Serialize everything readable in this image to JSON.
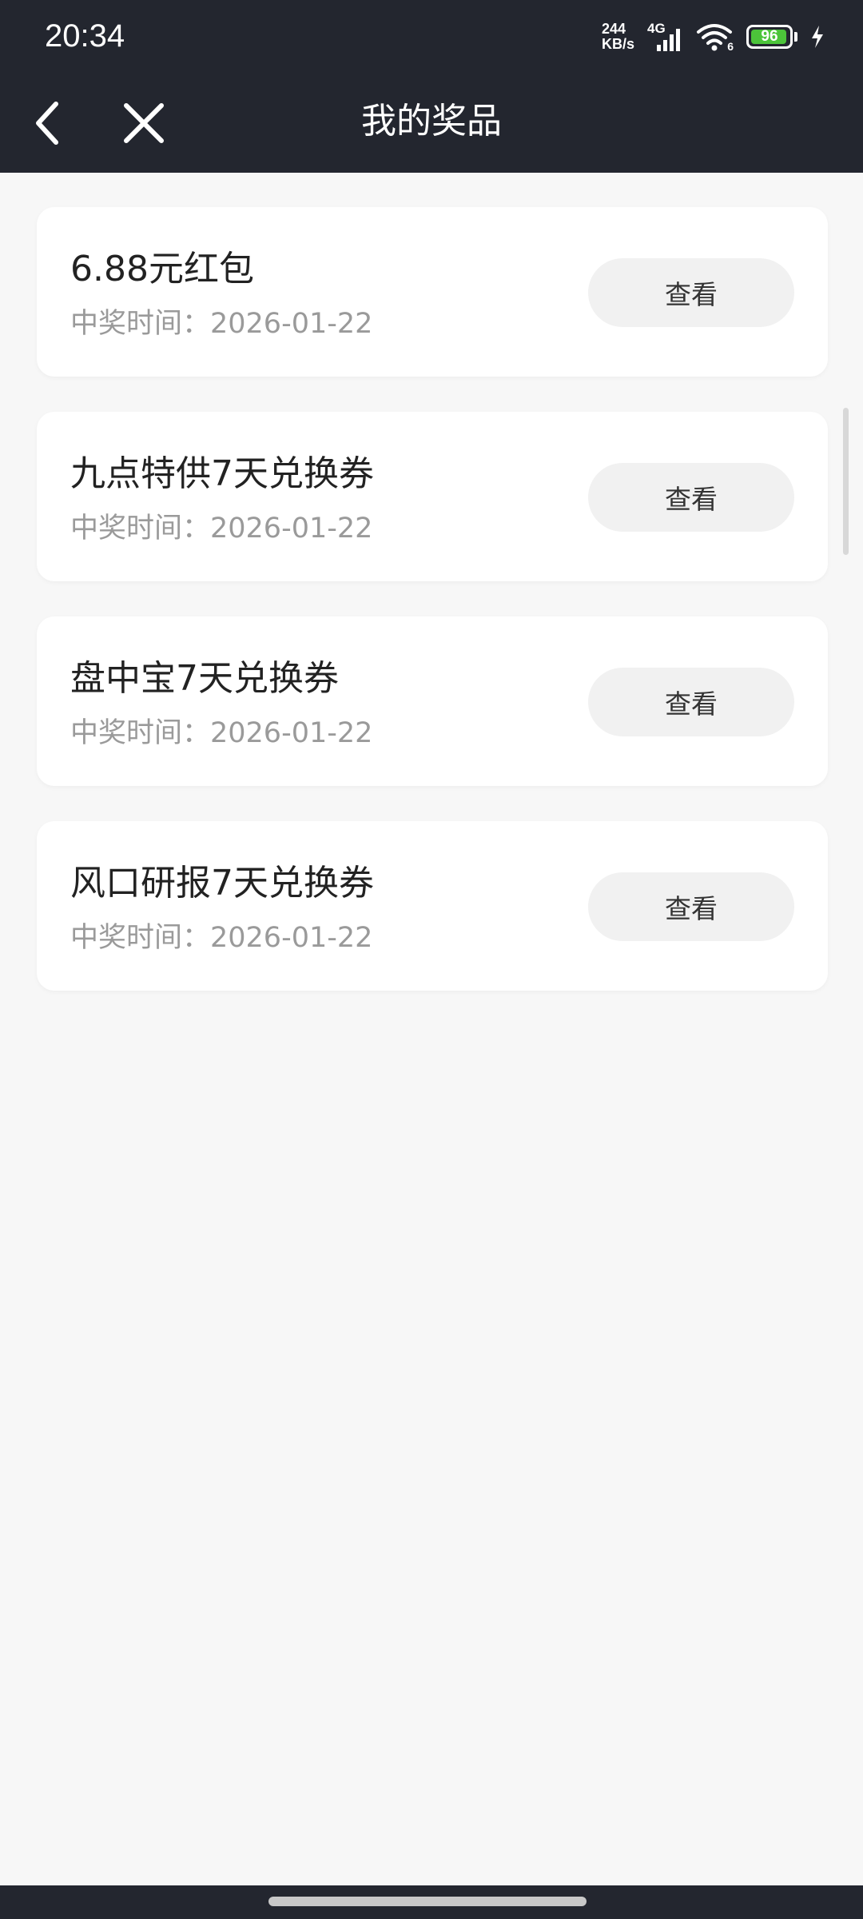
{
  "status_bar": {
    "time": "20:34",
    "net_speed_value": "244",
    "net_speed_unit": "KB/s",
    "network_type": "4G",
    "wifi_badge": "6",
    "battery_level": "96",
    "battery_fraction": 0.96,
    "icons": [
      "signal-icon",
      "wifi-icon",
      "battery-icon",
      "charging-icon"
    ]
  },
  "nav": {
    "title": "我的奖品",
    "icons": [
      "back-arrow-icon",
      "close-icon"
    ]
  },
  "prizes": [
    {
      "title": "6.88元红包",
      "time": "中奖时间：2026-01-22",
      "action": "查看"
    },
    {
      "title": "九点特供7天兑换券",
      "time": "中奖时间：2026-01-22",
      "action": "查看"
    },
    {
      "title": "盘中宝7天兑换券",
      "time": "中奖时间：2026-01-22",
      "action": "查看"
    },
    {
      "title": "风口研报7天兑换券",
      "time": "中奖时间：2026-01-22",
      "action": "查看"
    }
  ],
  "colors": {
    "header_bg": "#23262f",
    "page_bg": "#f7f7f7",
    "card_bg": "#ffffff",
    "button_bg": "#f1f1f1",
    "battery_green": "#4cc43a",
    "secondary_text": "#9a9a9a"
  }
}
